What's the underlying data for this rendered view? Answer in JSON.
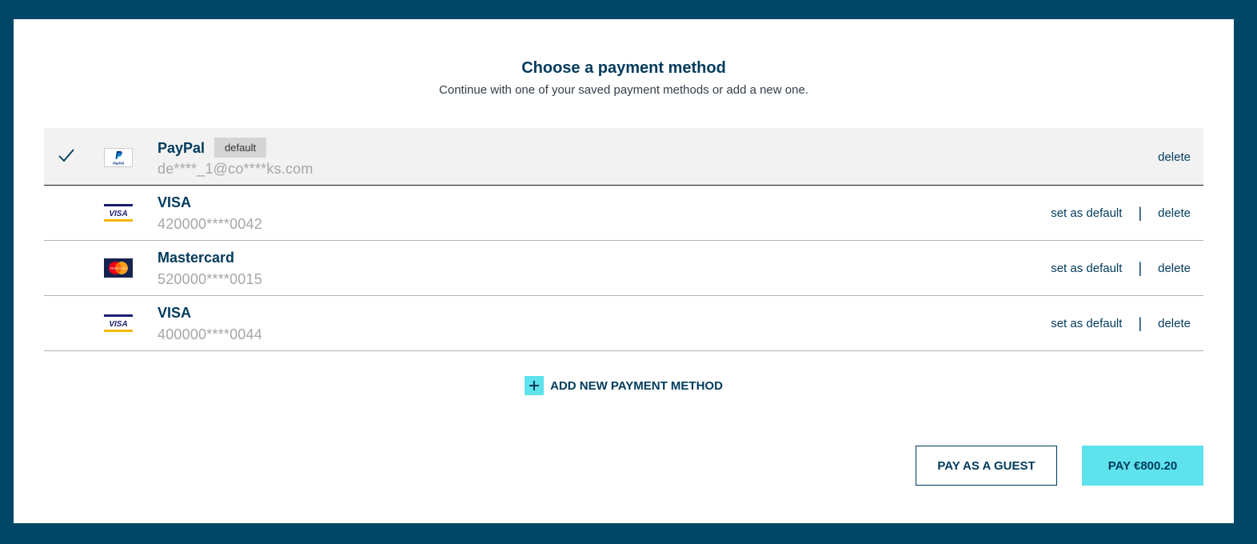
{
  "header": {
    "title": "Choose a payment method",
    "subtitle": "Continue with one of your saved payment methods or add a new one."
  },
  "methods": [
    {
      "name": "PayPal",
      "badge": "default",
      "detail": "de****_1@co****ks.com",
      "logo": "paypal-logo",
      "selected": true,
      "delete_label": "delete"
    },
    {
      "name": "VISA",
      "detail": "420000****0042",
      "logo": "visa-logo",
      "selected": false,
      "set_default_label": "set as default",
      "separator": "|",
      "delete_label": "delete"
    },
    {
      "name": "Mastercard",
      "detail": "520000****0015",
      "logo": "mastercard-logo",
      "selected": false,
      "set_default_label": "set as default",
      "separator": "|",
      "delete_label": "delete"
    },
    {
      "name": "VISA",
      "detail": "400000****0044",
      "logo": "visa-logo",
      "selected": false,
      "set_default_label": "set as default",
      "separator": "|",
      "delete_label": "delete"
    }
  ],
  "add_new": {
    "label": "ADD NEW PAYMENT METHOD",
    "icon": "plus-icon"
  },
  "buttons": {
    "guest_label": "PAY AS A GUEST",
    "pay_label": "PAY €800.20"
  },
  "icons": {
    "selected": "checkmark-icon"
  },
  "colors": {
    "background": "#004767",
    "brand": "#003a5c",
    "accent": "#5ee2ec",
    "muted": "#a6a6a6"
  }
}
